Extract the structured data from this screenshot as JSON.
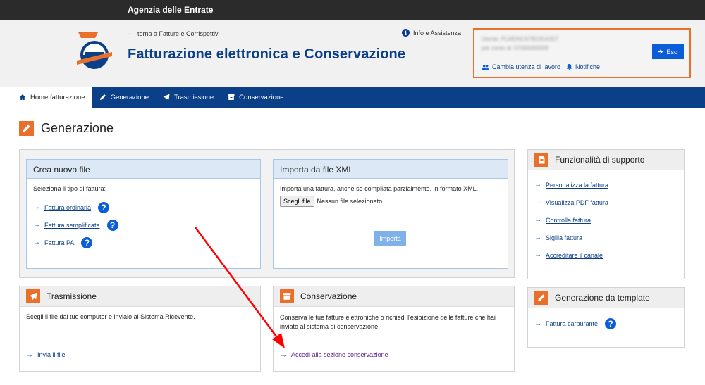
{
  "topbar": {
    "title": "Agenzia delle Entrate"
  },
  "header": {
    "back_link": "torna a Fatture e Corrispettivi",
    "app_title": "Fatturazione elettronica e Conservazione",
    "info_link": "Info e Assistenza"
  },
  "userbox": {
    "line1": "Utente: PLMDNC67B23G435T",
    "line2": "per conto di: 07000000000",
    "logout_label": "Esci",
    "change_workspace": "Cambia utenza di lavoro",
    "notifications": "Notifiche"
  },
  "nav": {
    "items": [
      {
        "label": "Home fatturazione"
      },
      {
        "label": "Generazione"
      },
      {
        "label": "Trasmissione"
      },
      {
        "label": "Conservazione"
      }
    ]
  },
  "page": {
    "title": "Generazione"
  },
  "crea": {
    "title": "Crea nuovo file",
    "instruction": "Seleziona il tipo di fattura:",
    "links": [
      {
        "label": "Fattura ordinaria"
      },
      {
        "label": "Fattura semplificata"
      },
      {
        "label": "Fattura PA"
      }
    ]
  },
  "importa": {
    "title": "Importa da file XML",
    "description": "Importa una fattura, anche se compilata parzialmente, in formato XML.",
    "file_button": "Scegli file",
    "file_status": "Nessun file selezionato",
    "import_button": "Importa"
  },
  "trasmissione": {
    "title": "Trasmissione",
    "description": "Scegli il file dal tuo computer e invialo al Sistema Ricevente.",
    "link": "Invia il file"
  },
  "conservazione": {
    "title": "Conservazione",
    "description": "Conserva le tue fatture elettroniche o richiedi l'esibizione delle fatture che hai inviato al sistema di conservazione.",
    "link": "Accedi alla sezione conservazione"
  },
  "supporto": {
    "title": "Funzionalità di supporto",
    "links": [
      {
        "label": "Personalizza la fattura"
      },
      {
        "label": "Visualizza PDF fattura"
      },
      {
        "label": "Controlla fattura"
      },
      {
        "label": "Sigilla fattura"
      },
      {
        "label": "Accreditare il canale"
      }
    ]
  },
  "template": {
    "title": "Generazione da template",
    "link": "Fattura carburante"
  },
  "colors": {
    "brand_blue": "#0b3f87",
    "accent_orange": "#e8702a",
    "annotation_red": "#ff0000"
  }
}
